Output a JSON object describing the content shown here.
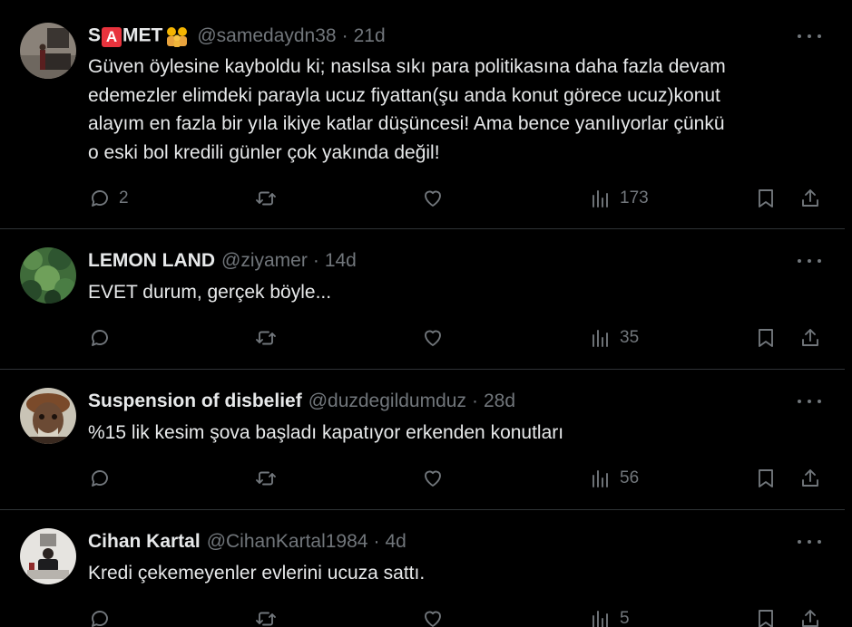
{
  "tweets": [
    {
      "name_pre": "S",
      "name_badge": "A",
      "name_post": "MET",
      "handle": "@samedaydn38",
      "time": "21d",
      "text_lines": [
        "Güven öylesine kayboldu ki; nasılsa sıkı para politikasına daha fazla devam",
        "edemezler elimdeki parayla ucuz fiyattan(şu anda konut görece ucuz)konut",
        "alayım en fazla bir yıla ikiye katlar düşüncesi! Ama bence yanılıyorlar çünkü",
        "o eski bol kredili günler çok yakında değil!"
      ],
      "replies": "2",
      "retweets": "",
      "likes": "",
      "views": "173"
    },
    {
      "name": "LEMON LAND",
      "handle": "@ziyamer",
      "time": "14d",
      "text_lines": [
        "EVET durum, gerçek böyle..."
      ],
      "replies": "",
      "retweets": "",
      "likes": "",
      "views": "35"
    },
    {
      "name": "Suspension of disbelief",
      "handle": "@duzdegildumduz",
      "time": "28d",
      "text_lines": [
        "%15 lik kesim şova başladı kapatıyor erkenden konutları"
      ],
      "replies": "",
      "retweets": "",
      "likes": "",
      "views": "56"
    },
    {
      "name": "Cihan Kartal",
      "handle": "@CihanKartal1984",
      "time": "4d",
      "text_lines": [
        "Kredi çekemeyenler evlerini ucuza sattı."
      ],
      "replies": "",
      "retweets": "",
      "likes": "",
      "views": "5"
    }
  ],
  "separator": "·",
  "colors": {
    "background": "#000000",
    "text": "#e7e9ea",
    "muted": "#71767b",
    "border": "#2f3336",
    "badge_red": "#e8333d"
  },
  "icons": [
    "reply-icon",
    "retweet-icon",
    "like-icon",
    "views-icon",
    "bookmark-icon",
    "share-icon",
    "more-icon"
  ]
}
